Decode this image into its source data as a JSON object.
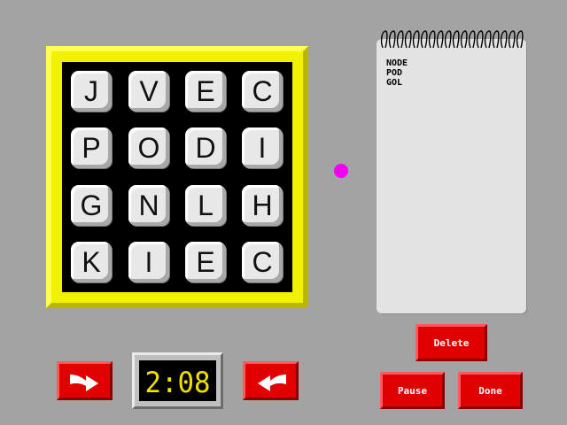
{
  "board": {
    "rows": [
      [
        "J",
        "V",
        "E",
        "C"
      ],
      [
        "P",
        "O",
        "D",
        "I"
      ],
      [
        "G",
        "N",
        "L",
        "H"
      ],
      [
        "K",
        "I",
        "E",
        "C"
      ]
    ]
  },
  "words_found": [
    "NODE",
    "POD",
    "GOL"
  ],
  "timer": {
    "display": "2:08"
  },
  "buttons": {
    "delete": "Delete",
    "pause": "Pause",
    "done": "Done"
  },
  "icons": {
    "rotate_right": "rotate-clockwise-arrow-icon",
    "rotate_left": "rotate-counterclockwise-arrow-icon"
  },
  "colors": {
    "background": "#a3a3a3",
    "frame": "#f2f200",
    "button": "#e00000",
    "digits": "#f0e000",
    "dot": "#f000f0"
  }
}
